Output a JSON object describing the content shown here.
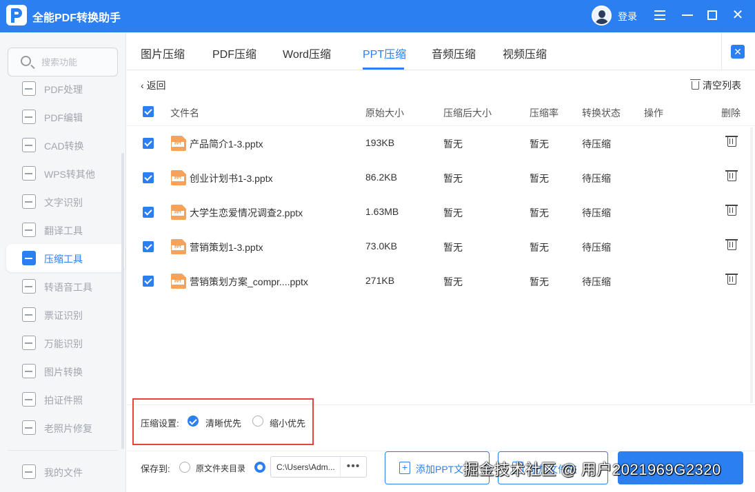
{
  "app": {
    "title": "全能PDF转换助手",
    "login_label": "登录"
  },
  "sidebar": {
    "search_placeholder": "搜索功能",
    "items": [
      {
        "label": "PDF处理",
        "icon": "pdf-process-icon",
        "active": false
      },
      {
        "label": "PDF编辑",
        "icon": "pdf-edit-icon",
        "active": false
      },
      {
        "label": "CAD转换",
        "icon": "cad-icon",
        "active": false
      },
      {
        "label": "WPS转其他",
        "icon": "wps-icon",
        "active": false
      },
      {
        "label": "文字识别",
        "icon": "ocr-icon",
        "active": false
      },
      {
        "label": "翻译工具",
        "icon": "translate-icon",
        "active": false
      },
      {
        "label": "压缩工具",
        "icon": "compress-icon",
        "active": true
      },
      {
        "label": "转语音工具",
        "icon": "speech-icon",
        "active": false
      },
      {
        "label": "票证识别",
        "icon": "ticket-icon",
        "active": false
      },
      {
        "label": "万能识别",
        "icon": "universal-recognize-icon",
        "active": false
      },
      {
        "label": "图片转换",
        "icon": "image-convert-icon",
        "active": false
      },
      {
        "label": "拍证件照",
        "icon": "id-photo-icon",
        "active": false
      },
      {
        "label": "老照片修复",
        "icon": "photo-restore-icon",
        "active": false
      }
    ],
    "my_files": "我的文件"
  },
  "tabs": [
    "图片压缩",
    "PDF压缩",
    "Word压缩",
    "PPT压缩",
    "音频压缩",
    "视频压缩"
  ],
  "active_tab": "PPT压缩",
  "toolbar": {
    "back_label": "返回",
    "clear_label": "清空列表"
  },
  "table": {
    "headers": {
      "name": "文件名",
      "orig": "原始大小",
      "after": "压缩后大小",
      "ratio": "压缩率",
      "status": "转换状态",
      "op": "操作",
      "del": "删除"
    },
    "rows": [
      {
        "name": "产品简介1-3.pptx",
        "orig": "193KB",
        "after": "暂无",
        "ratio": "暂无",
        "status": "待压缩"
      },
      {
        "name": "创业计划书1-3.pptx",
        "orig": "86.2KB",
        "after": "暂无",
        "ratio": "暂无",
        "status": "待压缩"
      },
      {
        "name": "大学生恋爱情况调查2.pptx",
        "orig": "1.63MB",
        "after": "暂无",
        "ratio": "暂无",
        "status": "待压缩"
      },
      {
        "name": "营销策划1-3.pptx",
        "orig": "73.0KB",
        "after": "暂无",
        "ratio": "暂无",
        "status": "待压缩"
      },
      {
        "name": "营销策划方案_compr....pptx",
        "orig": "271KB",
        "after": "暂无",
        "ratio": "暂无",
        "status": "待压缩"
      }
    ],
    "file_badge": "PPT"
  },
  "settings": {
    "label": "压缩设置:",
    "option_clear": "清晰优先",
    "option_small": "缩小优先",
    "selected": "清晰优先"
  },
  "output": {
    "save_label": "保存到:",
    "option_source": "原文件夹目录",
    "path": "C:\\Users\\Adm...",
    "dots": "•••"
  },
  "buttons": {
    "add_ppt": "添加PPT文",
    "add_folder": "添加文件夹"
  },
  "watermark": "掘金技术社区 @ 用户2021969G2320",
  "colors": {
    "accent": "#2b7ff0",
    "highlight_box": "#e8413c",
    "file_icon": "#f6a25a"
  }
}
